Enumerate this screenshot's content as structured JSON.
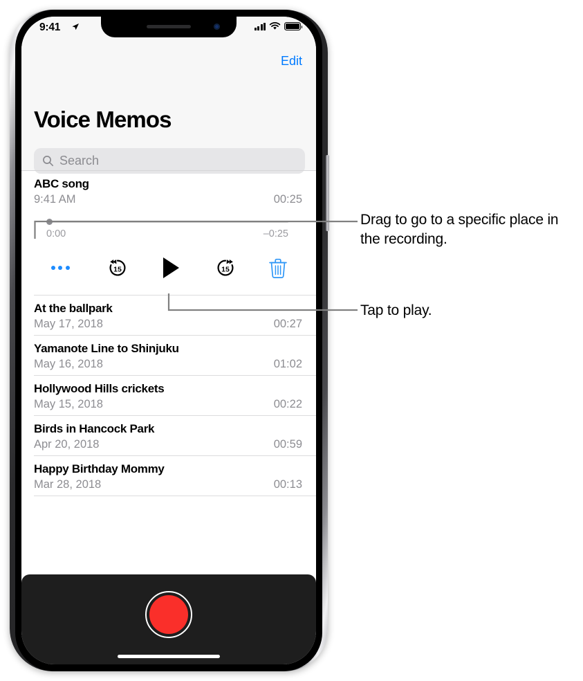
{
  "status_bar": {
    "time": "9:41",
    "location_icon": "location-arrow-icon",
    "signal_icon": "cellular-signal-icon",
    "wifi_icon": "wifi-icon",
    "battery_icon": "battery-full-icon"
  },
  "nav": {
    "edit_label": "Edit",
    "title": "Voice Memos"
  },
  "search": {
    "placeholder": "Search",
    "value": "",
    "icon": "search-icon"
  },
  "player": {
    "elapsed": "0:00",
    "remaining": "–0:25",
    "progress_percent": 0,
    "more_icon": "ellipsis-icon",
    "skip_back_label": "15",
    "skip_back_icon": "skip-back-15-icon",
    "play_icon": "play-icon",
    "skip_forward_label": "15",
    "skip_forward_icon": "skip-forward-15-icon",
    "delete_icon": "trash-icon"
  },
  "memos": [
    {
      "title": "ABC song",
      "date": "9:41 AM",
      "duration": "00:25",
      "expanded": true
    },
    {
      "title": "At the ballpark",
      "date": "May 17, 2018",
      "duration": "00:27",
      "expanded": false
    },
    {
      "title": "Yamanote Line to Shinjuku",
      "date": "May 16, 2018",
      "duration": "01:02",
      "expanded": false
    },
    {
      "title": "Hollywood Hills crickets",
      "date": "May 15, 2018",
      "duration": "00:22",
      "expanded": false
    },
    {
      "title": "Birds in Hancock Park",
      "date": "Apr 20, 2018",
      "duration": "00:59",
      "expanded": false
    },
    {
      "title": "Happy Birthday Mommy",
      "date": "Mar 28, 2018",
      "duration": "00:13",
      "expanded": false
    }
  ],
  "record": {
    "button_icon": "record-button-icon",
    "home_indicator": "home-indicator"
  },
  "callouts": [
    {
      "text": "Drag to go to a specific place in the recording.",
      "target": "scrubber"
    },
    {
      "text": "Tap to play.",
      "target": "play-button"
    }
  ],
  "colors": {
    "accent_blue": "#007AFF",
    "record_red": "#FA2F2A",
    "secondary_text": "#8D8D92",
    "header_bg": "#F7F7F7",
    "separator": "#DCDCDD",
    "record_bar_bg": "#1E1E1E",
    "callout_line": "#808080"
  }
}
